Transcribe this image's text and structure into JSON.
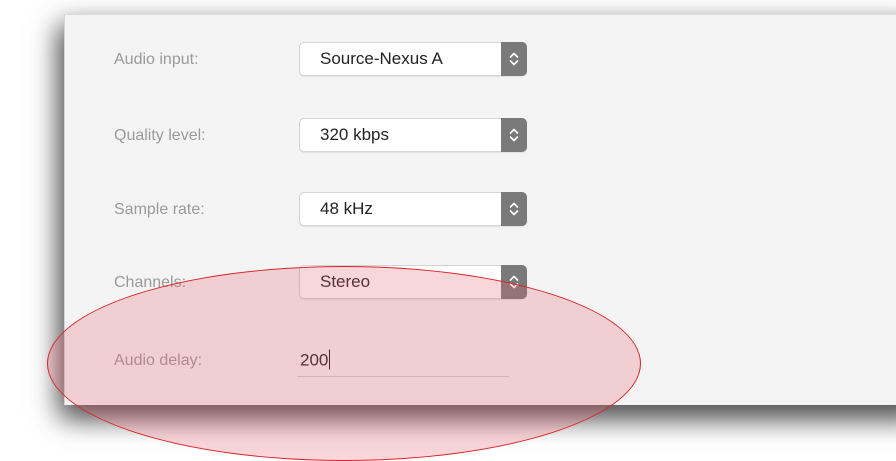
{
  "settings": {
    "audio_input": {
      "label": "Audio input:",
      "value": "Source-Nexus A"
    },
    "quality_level": {
      "label": "Quality level:",
      "value": "320 kbps"
    },
    "sample_rate": {
      "label": "Sample rate:",
      "value": "48 kHz"
    },
    "channels": {
      "label": "Channels:",
      "value": "Stereo"
    },
    "audio_delay": {
      "label": "Audio delay:",
      "value": "200"
    }
  },
  "icons": {
    "stepper": "chevron-up-down-icon"
  },
  "colors": {
    "panel_background": "#f4f4f4",
    "label_text": "#9a9a9a",
    "value_text": "#222222",
    "stepper_background": "#7a7a7a",
    "highlight_stroke": "#d8262a",
    "highlight_fill": "#e7606e"
  }
}
